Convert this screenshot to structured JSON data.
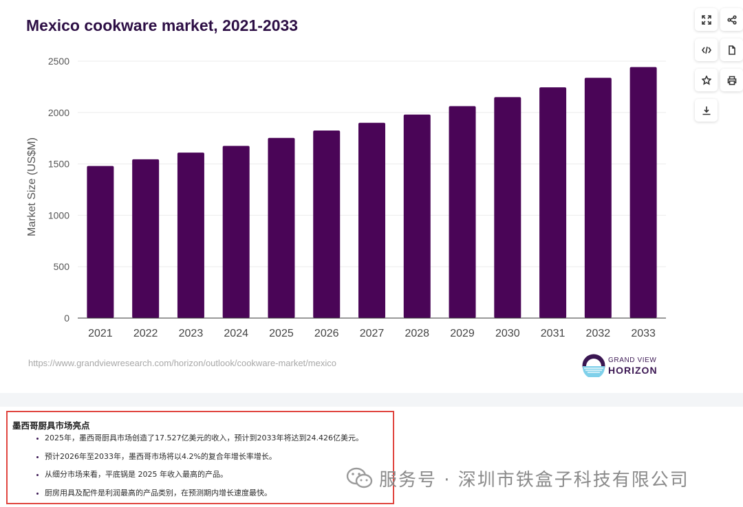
{
  "chart_data": {
    "type": "bar",
    "title": "Mexico cookware market, 2021-2033",
    "xlabel": "",
    "ylabel": "Market Size (US$M)",
    "ylim": [
      0,
      2500
    ],
    "yticks": [
      0,
      500,
      1000,
      1500,
      2000,
      2500
    ],
    "grid": true,
    "categories": [
      "2021",
      "2022",
      "2023",
      "2024",
      "2025",
      "2026",
      "2027",
      "2028",
      "2029",
      "2030",
      "2031",
      "2032",
      "2033"
    ],
    "values": [
      1480,
      1545,
      1610,
      1675,
      1752.7,
      1825,
      1900,
      1980,
      2062,
      2150,
      2245,
      2338,
      2442.6
    ],
    "bar_color": "#4a0557"
  },
  "toolbar": {
    "buttons": [
      "expand-icon",
      "share-icon",
      "embed-code-icon",
      "document-icon",
      "star-icon",
      "print-icon",
      "download-icon"
    ]
  },
  "source_url": "https://www.grandviewresearch.com/horizon/outlook/cookware-market/mexico",
  "brand": {
    "line1": "GRAND VIEW",
    "line2": "HORIZON"
  },
  "highlights": {
    "title": "墨西哥厨具市场亮点",
    "items": [
      "2025年，墨西哥厨具市场创造了17.527亿美元的收入，预计到2033年将达到24.426亿美元。",
      "预计2026年至2033年，墨西哥市场将以4.2%的复合年增长率增长。",
      "从细分市场来看，平底锅是 2025 年收入最高的产品。",
      "厨房用具及配件是利润最高的产品类别，在预测期内增长速度最快。"
    ]
  },
  "watermark": {
    "text": "服务号 · 深圳市铁盒子科技有限公司"
  },
  "colors": {
    "accent": "#4a0557",
    "title": "#2d0f45",
    "highlight_border": "#e0453f"
  }
}
